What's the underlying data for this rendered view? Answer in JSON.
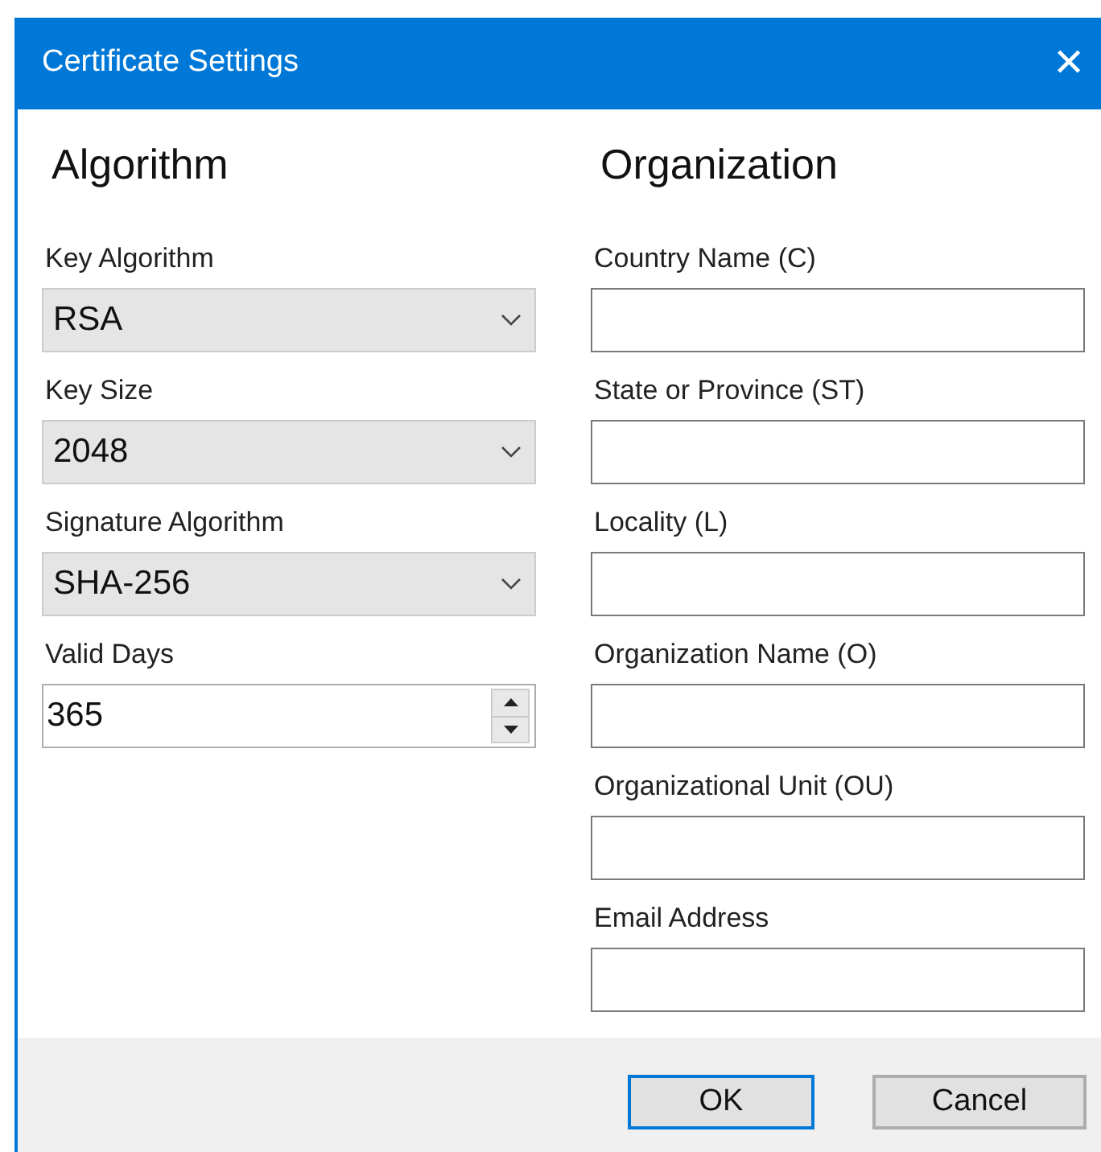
{
  "window": {
    "title": "Certificate Settings",
    "close_glyph": "✕"
  },
  "algorithm": {
    "heading": "Algorithm",
    "fields": [
      {
        "label": "Key Algorithm",
        "kind": "dropdown",
        "value": "RSA"
      },
      {
        "label": "Key Size",
        "kind": "dropdown",
        "value": "2048"
      },
      {
        "label": "Signature Algorithm",
        "kind": "dropdown",
        "value": "SHA-256"
      },
      {
        "label": "Valid Days",
        "kind": "spinner",
        "value": "365"
      }
    ]
  },
  "organization": {
    "heading": "Organization",
    "fields": [
      {
        "label": "Country Name (C)",
        "kind": "text"
      },
      {
        "label": "State or Province (ST)",
        "kind": "text"
      },
      {
        "label": "Locality (L)",
        "kind": "text"
      },
      {
        "label": "Organization Name (O)",
        "kind": "text"
      },
      {
        "label": "Organizational Unit (OU)",
        "kind": "text"
      },
      {
        "label": "Email Address",
        "kind": "text"
      }
    ]
  },
  "buttons": [
    {
      "label": "OK",
      "default": true
    },
    {
      "label": "Cancel",
      "default": false
    }
  ]
}
